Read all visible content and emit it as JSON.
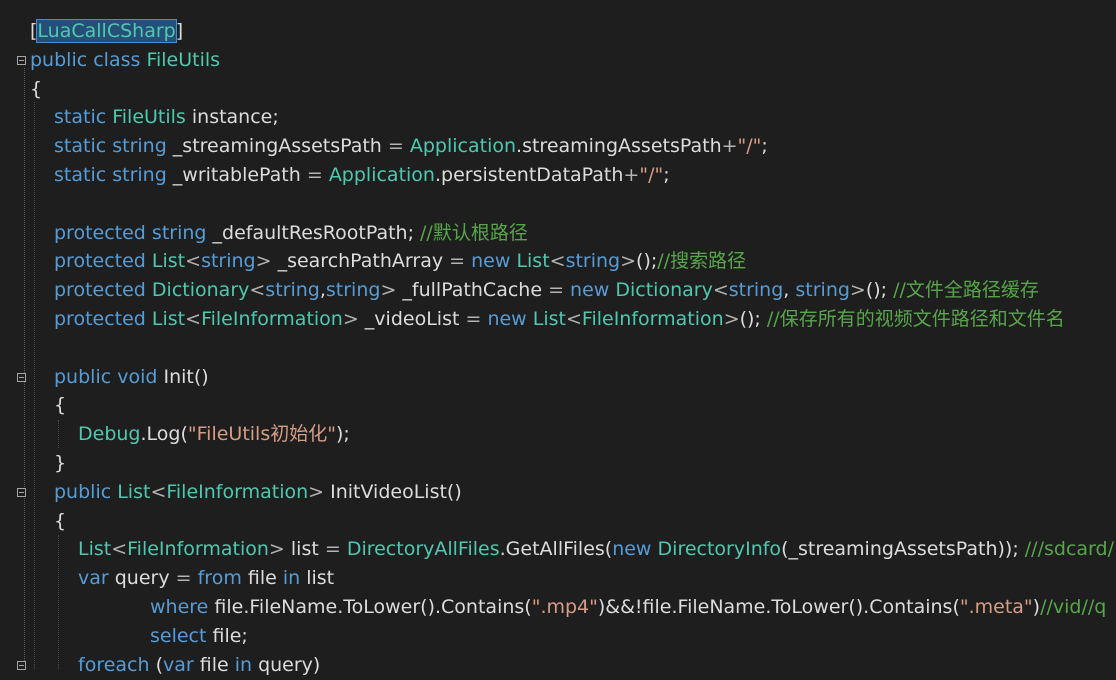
{
  "lines": [
    {
      "indent": 30,
      "tokens": [
        {
          "c": "pl",
          "t": "["
        },
        {
          "c": "sel",
          "t": "LuaCallCSharp"
        },
        {
          "c": "pl",
          "t": "]"
        }
      ]
    },
    {
      "indent": 30,
      "fold": true,
      "tokens": [
        {
          "c": "kw",
          "t": "public"
        },
        {
          "c": "pl",
          "t": " "
        },
        {
          "c": "kw",
          "t": "class"
        },
        {
          "c": "pl",
          "t": " "
        },
        {
          "c": "ty",
          "t": "FileUtils"
        }
      ]
    },
    {
      "indent": 30,
      "tokens": [
        {
          "c": "pl",
          "t": "{"
        }
      ]
    },
    {
      "indent": 54,
      "tokens": [
        {
          "c": "kw",
          "t": "static"
        },
        {
          "c": "pl",
          "t": " "
        },
        {
          "c": "ty",
          "t": "FileUtils"
        },
        {
          "c": "pl",
          "t": " instance;"
        }
      ]
    },
    {
      "indent": 54,
      "tokens": [
        {
          "c": "kw",
          "t": "static"
        },
        {
          "c": "pl",
          "t": " "
        },
        {
          "c": "kw",
          "t": "string"
        },
        {
          "c": "pl",
          "t": " _streamingAssetsPath "
        },
        {
          "c": "op",
          "t": "="
        },
        {
          "c": "pl",
          "t": " "
        },
        {
          "c": "ty",
          "t": "Application"
        },
        {
          "c": "pl",
          "t": ".streamingAssetsPath"
        },
        {
          "c": "op",
          "t": "+"
        },
        {
          "c": "st",
          "t": "\"/\""
        },
        {
          "c": "pl",
          "t": ";"
        }
      ]
    },
    {
      "indent": 54,
      "tokens": [
        {
          "c": "kw",
          "t": "static"
        },
        {
          "c": "pl",
          "t": " "
        },
        {
          "c": "kw",
          "t": "string"
        },
        {
          "c": "pl",
          "t": " _writablePath "
        },
        {
          "c": "op",
          "t": "="
        },
        {
          "c": "pl",
          "t": " "
        },
        {
          "c": "ty",
          "t": "Application"
        },
        {
          "c": "pl",
          "t": ".persistentDataPath"
        },
        {
          "c": "op",
          "t": "+"
        },
        {
          "c": "st",
          "t": "\"/\""
        },
        {
          "c": "pl",
          "t": ";"
        }
      ]
    },
    {
      "indent": 54,
      "tokens": []
    },
    {
      "indent": 54,
      "tokens": [
        {
          "c": "kw",
          "t": "protected"
        },
        {
          "c": "pl",
          "t": " "
        },
        {
          "c": "kw",
          "t": "string"
        },
        {
          "c": "pl",
          "t": " _defaultResRootPath; "
        },
        {
          "c": "cm",
          "t": "//默认根路径"
        }
      ]
    },
    {
      "indent": 54,
      "tokens": [
        {
          "c": "kw",
          "t": "protected"
        },
        {
          "c": "pl",
          "t": " "
        },
        {
          "c": "ty",
          "t": "List"
        },
        {
          "c": "op",
          "t": "<"
        },
        {
          "c": "kw",
          "t": "string"
        },
        {
          "c": "op",
          "t": ">"
        },
        {
          "c": "pl",
          "t": " _searchPathArray "
        },
        {
          "c": "op",
          "t": "="
        },
        {
          "c": "pl",
          "t": " "
        },
        {
          "c": "kw",
          "t": "new"
        },
        {
          "c": "pl",
          "t": " "
        },
        {
          "c": "ty",
          "t": "List"
        },
        {
          "c": "op",
          "t": "<"
        },
        {
          "c": "kw",
          "t": "string"
        },
        {
          "c": "op",
          "t": ">"
        },
        {
          "c": "pl",
          "t": "();"
        },
        {
          "c": "cm",
          "t": "//搜索路径"
        }
      ]
    },
    {
      "indent": 54,
      "tokens": [
        {
          "c": "kw",
          "t": "protected"
        },
        {
          "c": "pl",
          "t": " "
        },
        {
          "c": "ty",
          "t": "Dictionary"
        },
        {
          "c": "op",
          "t": "<"
        },
        {
          "c": "kw",
          "t": "string"
        },
        {
          "c": "pl",
          "t": ","
        },
        {
          "c": "kw",
          "t": "string"
        },
        {
          "c": "op",
          "t": ">"
        },
        {
          "c": "pl",
          "t": " _fullPathCache "
        },
        {
          "c": "op",
          "t": "="
        },
        {
          "c": "pl",
          "t": " "
        },
        {
          "c": "kw",
          "t": "new"
        },
        {
          "c": "pl",
          "t": " "
        },
        {
          "c": "ty",
          "t": "Dictionary"
        },
        {
          "c": "op",
          "t": "<"
        },
        {
          "c": "kw",
          "t": "string"
        },
        {
          "c": "pl",
          "t": ", "
        },
        {
          "c": "kw",
          "t": "string"
        },
        {
          "c": "op",
          "t": ">"
        },
        {
          "c": "pl",
          "t": "(); "
        },
        {
          "c": "cm",
          "t": "//文件全路径缓存"
        }
      ]
    },
    {
      "indent": 54,
      "tokens": [
        {
          "c": "kw",
          "t": "protected"
        },
        {
          "c": "pl",
          "t": " "
        },
        {
          "c": "ty",
          "t": "List"
        },
        {
          "c": "op",
          "t": "<"
        },
        {
          "c": "ty",
          "t": "FileInformation"
        },
        {
          "c": "op",
          "t": ">"
        },
        {
          "c": "pl",
          "t": " _videoList "
        },
        {
          "c": "op",
          "t": "="
        },
        {
          "c": "pl",
          "t": " "
        },
        {
          "c": "kw",
          "t": "new"
        },
        {
          "c": "pl",
          "t": " "
        },
        {
          "c": "ty",
          "t": "List"
        },
        {
          "c": "op",
          "t": "<"
        },
        {
          "c": "ty",
          "t": "FileInformation"
        },
        {
          "c": "op",
          "t": ">"
        },
        {
          "c": "pl",
          "t": "(); "
        },
        {
          "c": "cm",
          "t": "//保存所有的视频文件路径和文件名"
        }
      ]
    },
    {
      "indent": 54,
      "tokens": []
    },
    {
      "indent": 54,
      "fold": true,
      "tokens": [
        {
          "c": "kw",
          "t": "public"
        },
        {
          "c": "pl",
          "t": " "
        },
        {
          "c": "kw",
          "t": "void"
        },
        {
          "c": "pl",
          "t": " Init()"
        }
      ]
    },
    {
      "indent": 54,
      "tokens": [
        {
          "c": "pl",
          "t": "{"
        }
      ]
    },
    {
      "indent": 78,
      "tokens": [
        {
          "c": "ty",
          "t": "Debug"
        },
        {
          "c": "pl",
          "t": ".Log("
        },
        {
          "c": "st",
          "t": "\"FileUtils初始化\""
        },
        {
          "c": "pl",
          "t": ");"
        }
      ]
    },
    {
      "indent": 54,
      "tokens": [
        {
          "c": "pl",
          "t": "}"
        }
      ]
    },
    {
      "indent": 54,
      "fold": true,
      "tokens": [
        {
          "c": "kw",
          "t": "public"
        },
        {
          "c": "pl",
          "t": " "
        },
        {
          "c": "ty",
          "t": "List"
        },
        {
          "c": "op",
          "t": "<"
        },
        {
          "c": "ty",
          "t": "FileInformation"
        },
        {
          "c": "op",
          "t": ">"
        },
        {
          "c": "pl",
          "t": " InitVideoList()"
        }
      ]
    },
    {
      "indent": 54,
      "tokens": [
        {
          "c": "pl",
          "t": "{"
        }
      ]
    },
    {
      "indent": 78,
      "tokens": [
        {
          "c": "ty",
          "t": "List"
        },
        {
          "c": "op",
          "t": "<"
        },
        {
          "c": "ty",
          "t": "FileInformation"
        },
        {
          "c": "op",
          "t": ">"
        },
        {
          "c": "pl",
          "t": " list "
        },
        {
          "c": "op",
          "t": "="
        },
        {
          "c": "pl",
          "t": " "
        },
        {
          "c": "ty",
          "t": "DirectoryAllFiles"
        },
        {
          "c": "pl",
          "t": ".GetAllFiles("
        },
        {
          "c": "kw",
          "t": "new"
        },
        {
          "c": "pl",
          "t": " "
        },
        {
          "c": "ty",
          "t": "DirectoryInfo"
        },
        {
          "c": "pl",
          "t": "(_streamingAssetsPath)); "
        },
        {
          "c": "cm",
          "t": "///sdcard/"
        }
      ]
    },
    {
      "indent": 78,
      "tokens": [
        {
          "c": "kw",
          "t": "var"
        },
        {
          "c": "pl",
          "t": " query "
        },
        {
          "c": "op",
          "t": "="
        },
        {
          "c": "pl",
          "t": " "
        },
        {
          "c": "kw",
          "t": "from"
        },
        {
          "c": "pl",
          "t": " file "
        },
        {
          "c": "kw",
          "t": "in"
        },
        {
          "c": "pl",
          "t": " list"
        }
      ]
    },
    {
      "indent": 150,
      "tokens": [
        {
          "c": "kw",
          "t": "where"
        },
        {
          "c": "pl",
          "t": " file.FileName.ToLower().Contains("
        },
        {
          "c": "st",
          "t": "\".mp4\""
        },
        {
          "c": "pl",
          "t": ")&&!file.FileName.ToLower().Contains("
        },
        {
          "c": "st",
          "t": "\".meta\""
        },
        {
          "c": "pl",
          "t": ")"
        },
        {
          "c": "cm",
          "t": "//vid//q"
        }
      ]
    },
    {
      "indent": 150,
      "tokens": [
        {
          "c": "kw",
          "t": "select"
        },
        {
          "c": "pl",
          "t": " file;"
        }
      ]
    },
    {
      "indent": 78,
      "fold": true,
      "tokens": [
        {
          "c": "kw",
          "t": "foreach"
        },
        {
          "c": "pl",
          "t": " ("
        },
        {
          "c": "kw",
          "t": "var"
        },
        {
          "c": "pl",
          "t": " file "
        },
        {
          "c": "kw",
          "t": "in"
        },
        {
          "c": "pl",
          "t": " query)"
        }
      ]
    }
  ]
}
